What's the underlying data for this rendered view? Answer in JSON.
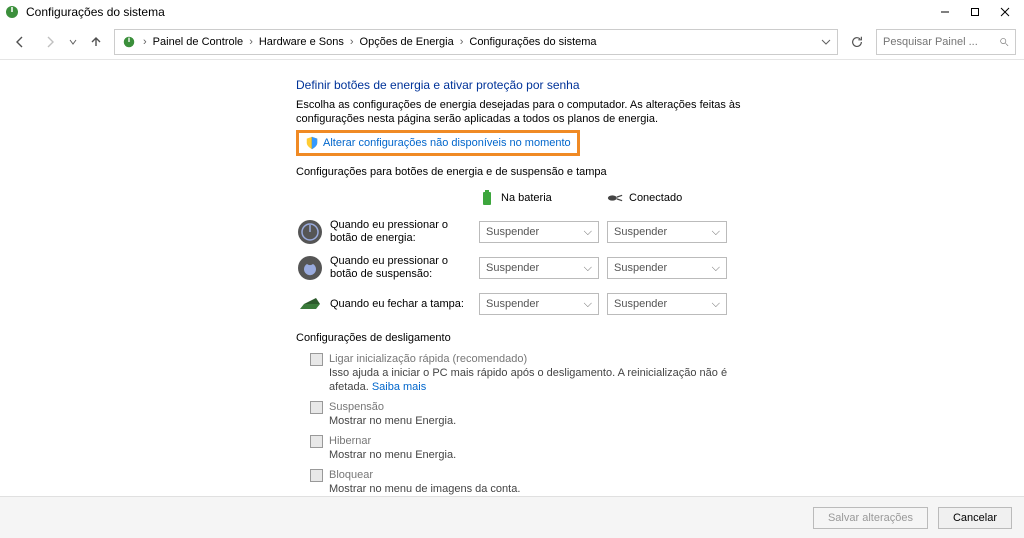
{
  "window": {
    "title": "Configurações do sistema"
  },
  "breadcrumb": {
    "items": [
      "Painel de Controle",
      "Hardware e Sons",
      "Opções de Energia",
      "Configurações do sistema"
    ]
  },
  "search": {
    "placeholder": "Pesquisar Painel ..."
  },
  "main": {
    "heading": "Definir botões de energia e ativar proteção por senha",
    "intro": "Escolha as configurações de energia desejadas para o computador. As alterações feitas às configurações nesta página serão aplicadas a todos os planos de energia.",
    "change_link": "Alterar configurações não disponíveis no momento",
    "section1_title": "Configurações para botões de energia e de suspensão e tampa",
    "col_battery": "Na bateria",
    "col_plugged": "Conectado",
    "rows": [
      {
        "label": "Quando eu pressionar o botão de energia:",
        "battery": "Suspender",
        "plugged": "Suspender"
      },
      {
        "label": "Quando eu pressionar o botão de suspensão:",
        "battery": "Suspender",
        "plugged": "Suspender"
      },
      {
        "label": "Quando eu fechar a tampa:",
        "battery": "Suspender",
        "plugged": "Suspender"
      }
    ],
    "section2_title": "Configurações de desligamento",
    "shutdown_opts": [
      {
        "title": "Ligar inicialização rápida (recomendado)",
        "desc": "Isso ajuda a iniciar o PC mais rápido após o desligamento. A reinicialização não é afetada. ",
        "link": "Saiba mais"
      },
      {
        "title": "Suspensão",
        "desc": "Mostrar no menu Energia."
      },
      {
        "title": "Hibernar",
        "desc": "Mostrar no menu Energia."
      },
      {
        "title": "Bloquear",
        "desc": "Mostrar no menu de imagens da conta."
      }
    ]
  },
  "footer": {
    "save": "Salvar alterações",
    "cancel": "Cancelar"
  }
}
